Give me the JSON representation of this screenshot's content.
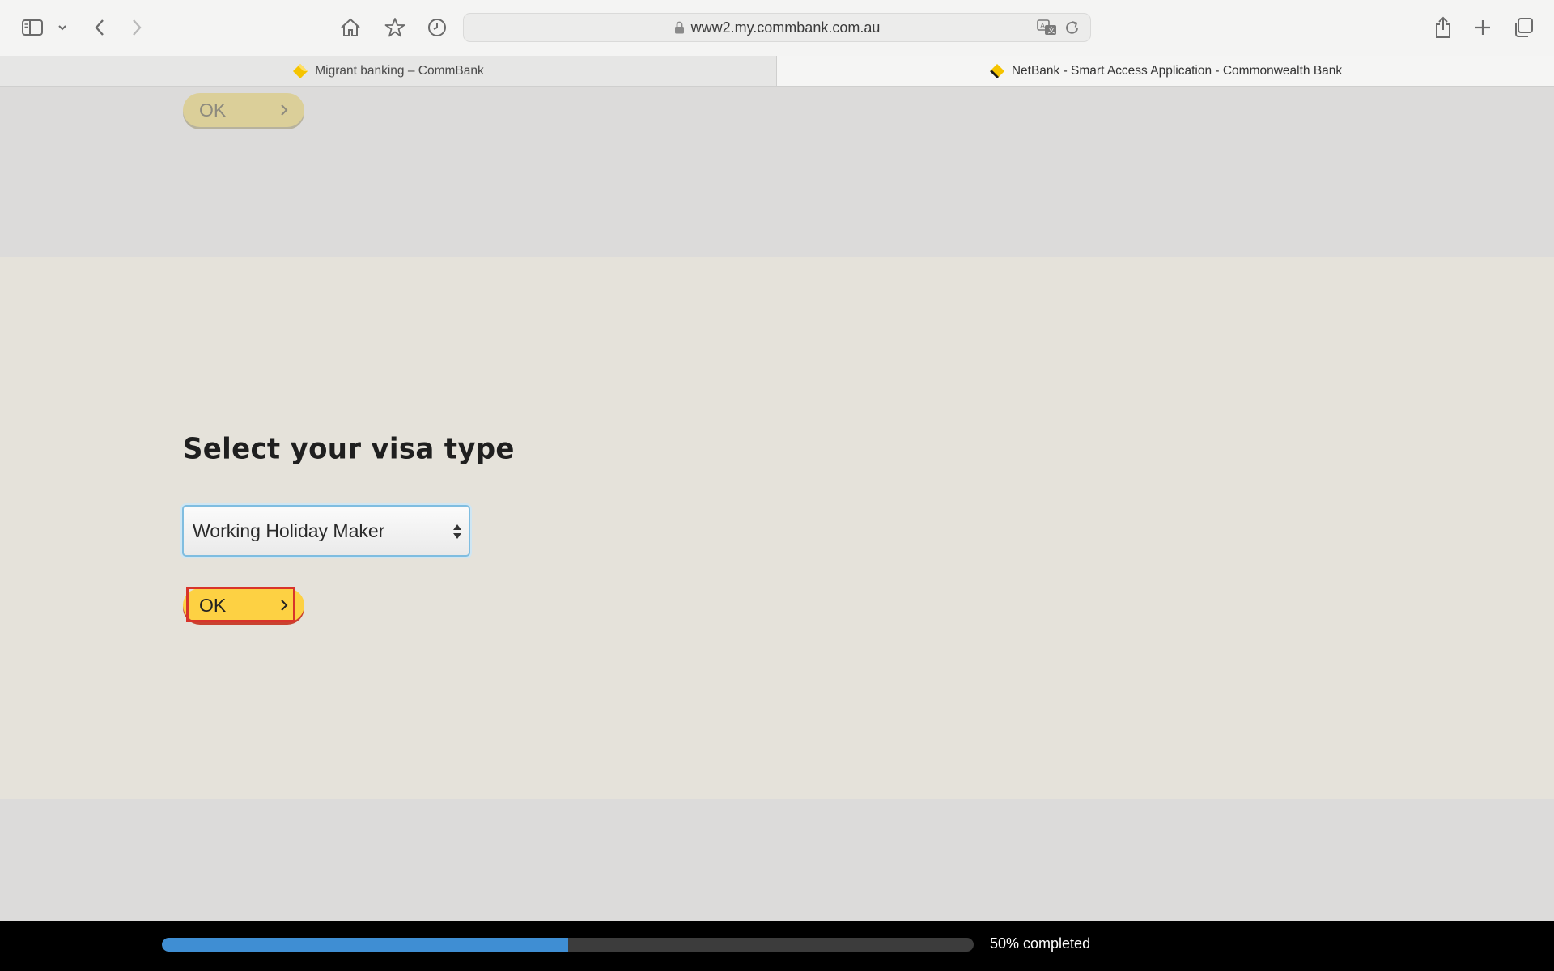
{
  "browser": {
    "url": "www2.my.commbank.com.au",
    "tabs": [
      {
        "label": "Migrant banking – CommBank",
        "active": false
      },
      {
        "label": "NetBank - Smart Access Application - Commonwealth Bank",
        "active": true
      }
    ],
    "icons": [
      "sidebar-icon",
      "chevron-down-icon",
      "back-icon",
      "forward-icon",
      "home-icon",
      "star-icon",
      "history-icon",
      "lock-icon",
      "translate-icon",
      "reload-icon",
      "share-icon",
      "plus-icon",
      "tabs-overview-icon"
    ]
  },
  "page": {
    "previous_ok_label": "OK",
    "heading": "Select your visa type",
    "visa_select": {
      "selected": "Working Holiday Maker"
    },
    "ok_label": "OK"
  },
  "progress": {
    "percent": 50,
    "label": "50% completed"
  },
  "colors": {
    "accent_yellow": "#fdd143",
    "progress_blue": "#3f8ed3",
    "highlight_red": "#d8342a"
  }
}
